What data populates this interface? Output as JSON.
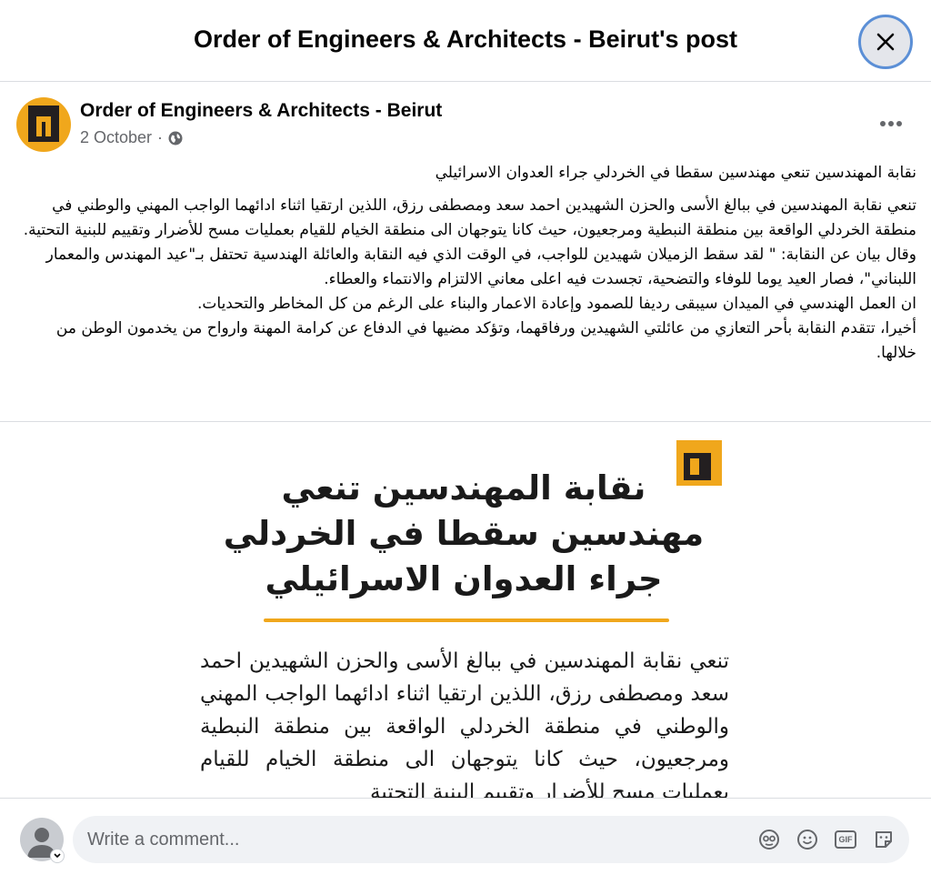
{
  "modal": {
    "title": "Order of Engineers & Architects - Beirut's post"
  },
  "post": {
    "page_name": "Order of Engineers & Architects - Beirut",
    "date": "2 October",
    "audience_icon": "globe-icon",
    "more_icon": "more-horizontal-icon",
    "headline": "نقابة المهندسين تنعي مهندسين سقطا في الخردلي جراء العدوان الاسرائيلي",
    "body_lines": [
      "تنعي نقابة المهندسين في ببالغ الأسى والحزن الشهيدين احمد سعد ومصطفى رزق، اللذين ارتقيا اثناء ادائهما الواجب المهني والوطني في منطقة الخردلي الواقعة بين منطقة النبطية ومرجعيون، حيث كانا يتوجهان الى منطقة الخيام للقيام بعمليات مسح للأضرار وتقييم للبنية التحتية.",
      "وقال بيان عن النقابة: \" لقد سقط الزميلان شهيدين للواجب، في الوقت الذي فيه النقابة والعائلة الهندسية تحتفل بـ\"عيد المهندس والمعمار اللبناني\"، فصار العيد يوما للوفاء والتضحية، تجسدت فيه اعلى معاني الالتزام والانتماء والعطاء.",
      "ان العمل الهندسي في الميدان سيبقى رديفا للصمود وإعادة الاعمار والبناء على الرغم من كل المخاطر والتحديات.",
      "أخيرا، تتقدم النقابة بأحر التعازي من عائلتي الشهيدين ورفاقهما، وتؤكد مضيها في الدفاع عن كرامة المهنة وارواح من يخدمون الوطن من خلالها."
    ]
  },
  "image": {
    "headline_lines": [
      "نقابة المهندسين تنعي",
      "مهندسين سقطا في الخردلي",
      "جراء العدوان الاسرائيلي"
    ],
    "body": "تنعي نقابة المهندسين في ببالغ الأسى والحزن الشهيدين احمد سعد ومصطفى رزق، اللذين ارتقيا اثناء ادائهما الواجب المهني والوطني في منطقة الخردلي الواقعة بين منطقة النبطية ومرجعيون، حيث كانا يتوجهان الى منطقة الخيام للقيام بعمليات مسح للأضرار وتقييم البنية التحتية",
    "accent_color": "#f0a71c"
  },
  "comment": {
    "placeholder": "Write a comment...",
    "tools": [
      "avatar-sticker-icon",
      "emoji-icon",
      "gif-icon",
      "sticker-icon"
    ],
    "gif_label": "GIF"
  }
}
